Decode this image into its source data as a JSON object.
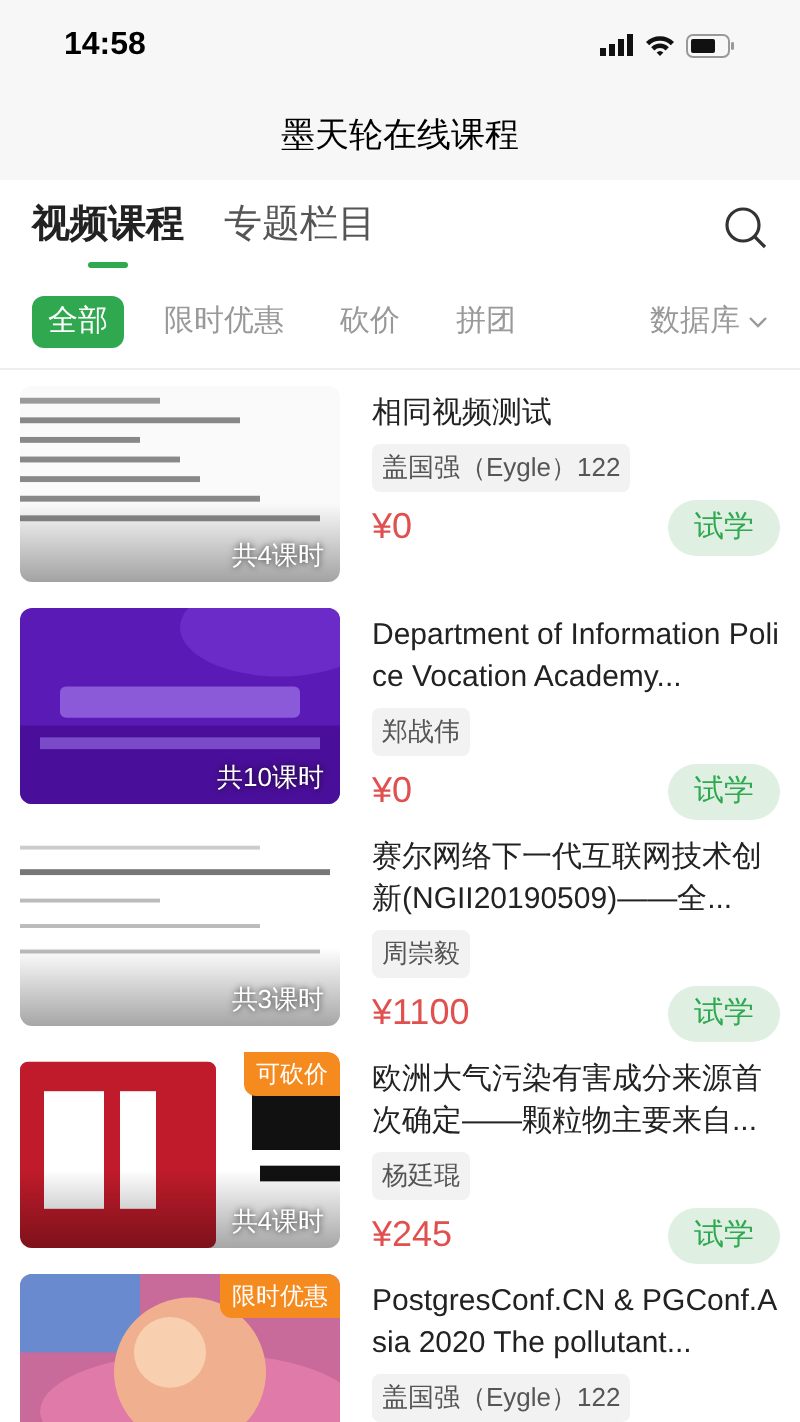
{
  "status_bar": {
    "time": "14:58"
  },
  "header": {
    "title": "墨天轮在线课程"
  },
  "tabs": [
    {
      "label": "视频课程",
      "selected": true
    },
    {
      "label": "专题栏目",
      "selected": false
    }
  ],
  "filters": [
    {
      "label": "全部",
      "selected": true
    },
    {
      "label": "限时优惠",
      "selected": false
    },
    {
      "label": "砍价",
      "selected": false
    },
    {
      "label": "拼团",
      "selected": false
    }
  ],
  "category": {
    "label": "数据库"
  },
  "courses": [
    {
      "title": "相同视频测试",
      "author": "盖国强（Eygle）122",
      "price": "¥0",
      "lessons": "共4课时",
      "action": "试学"
    },
    {
      "title": "Department of Information Police Vocation Academy...",
      "author": "郑战伟",
      "price": "¥0",
      "lessons": "共10课时",
      "action": "试学"
    },
    {
      "title": "赛尔网络下一代互联网技术创新(NGII20190509)——全...",
      "author": "周崇毅",
      "price": "¥1100",
      "lessons": "共3课时",
      "action": "试学"
    },
    {
      "title": "欧洲大气污染有害成分来源首次确定——颗粒物主要来自...",
      "author": "杨廷琨",
      "price": "¥245",
      "lessons": "共4课时",
      "action": "试学",
      "badge": "可砍价"
    },
    {
      "title": "PostgresConf.CN & PGConf.Asia 2020 The pollutant...",
      "author": "盖国强（Eygle）122",
      "badge": "限时优惠"
    }
  ]
}
